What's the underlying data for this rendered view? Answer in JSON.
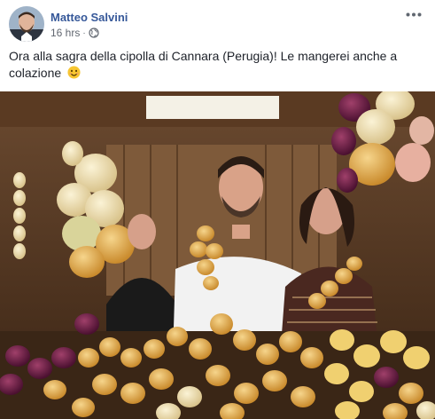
{
  "post": {
    "author": "Matteo Salvini",
    "timestamp": "16 hrs",
    "separator": "·",
    "audience_icon": "globe-icon",
    "more_icon": "more-options-icon",
    "caption_line1": "Ora alla sagra della cipolla di Cannara (Perugia)! Le mangerei anche a",
    "caption_line2": "colazione",
    "caption_emoji": "smiling-face-emoji"
  },
  "colors": {
    "author_link": "#365899",
    "meta_text": "#616770",
    "body_text": "#1d2129"
  }
}
